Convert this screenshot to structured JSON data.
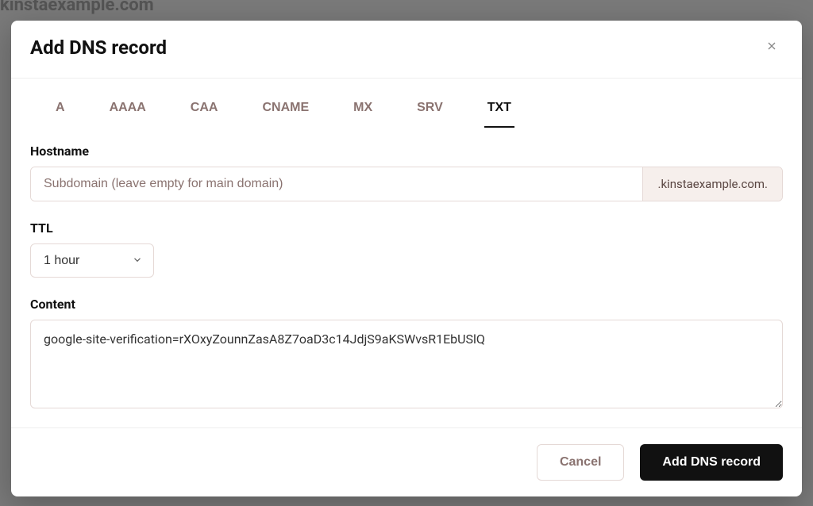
{
  "modal": {
    "title": "Add DNS record",
    "tabs": [
      {
        "label": "A",
        "active": false
      },
      {
        "label": "AAAA",
        "active": false
      },
      {
        "label": "CAA",
        "active": false
      },
      {
        "label": "CNAME",
        "active": false
      },
      {
        "label": "MX",
        "active": false
      },
      {
        "label": "SRV",
        "active": false
      },
      {
        "label": "TXT",
        "active": true
      }
    ],
    "hostname": {
      "label": "Hostname",
      "placeholder": "Subdomain (leave empty for main domain)",
      "value": "",
      "suffix": ".kinstaexample.com."
    },
    "ttl": {
      "label": "TTL",
      "value": "1 hour",
      "options": [
        "1 hour"
      ]
    },
    "content": {
      "label": "Content",
      "value": "google-site-verification=rXOxyZounnZasA8Z7oaD3c14JdjS9aKSWvsR1EbUSlQ"
    },
    "buttons": {
      "cancel": "Cancel",
      "submit": "Add DNS record"
    }
  }
}
